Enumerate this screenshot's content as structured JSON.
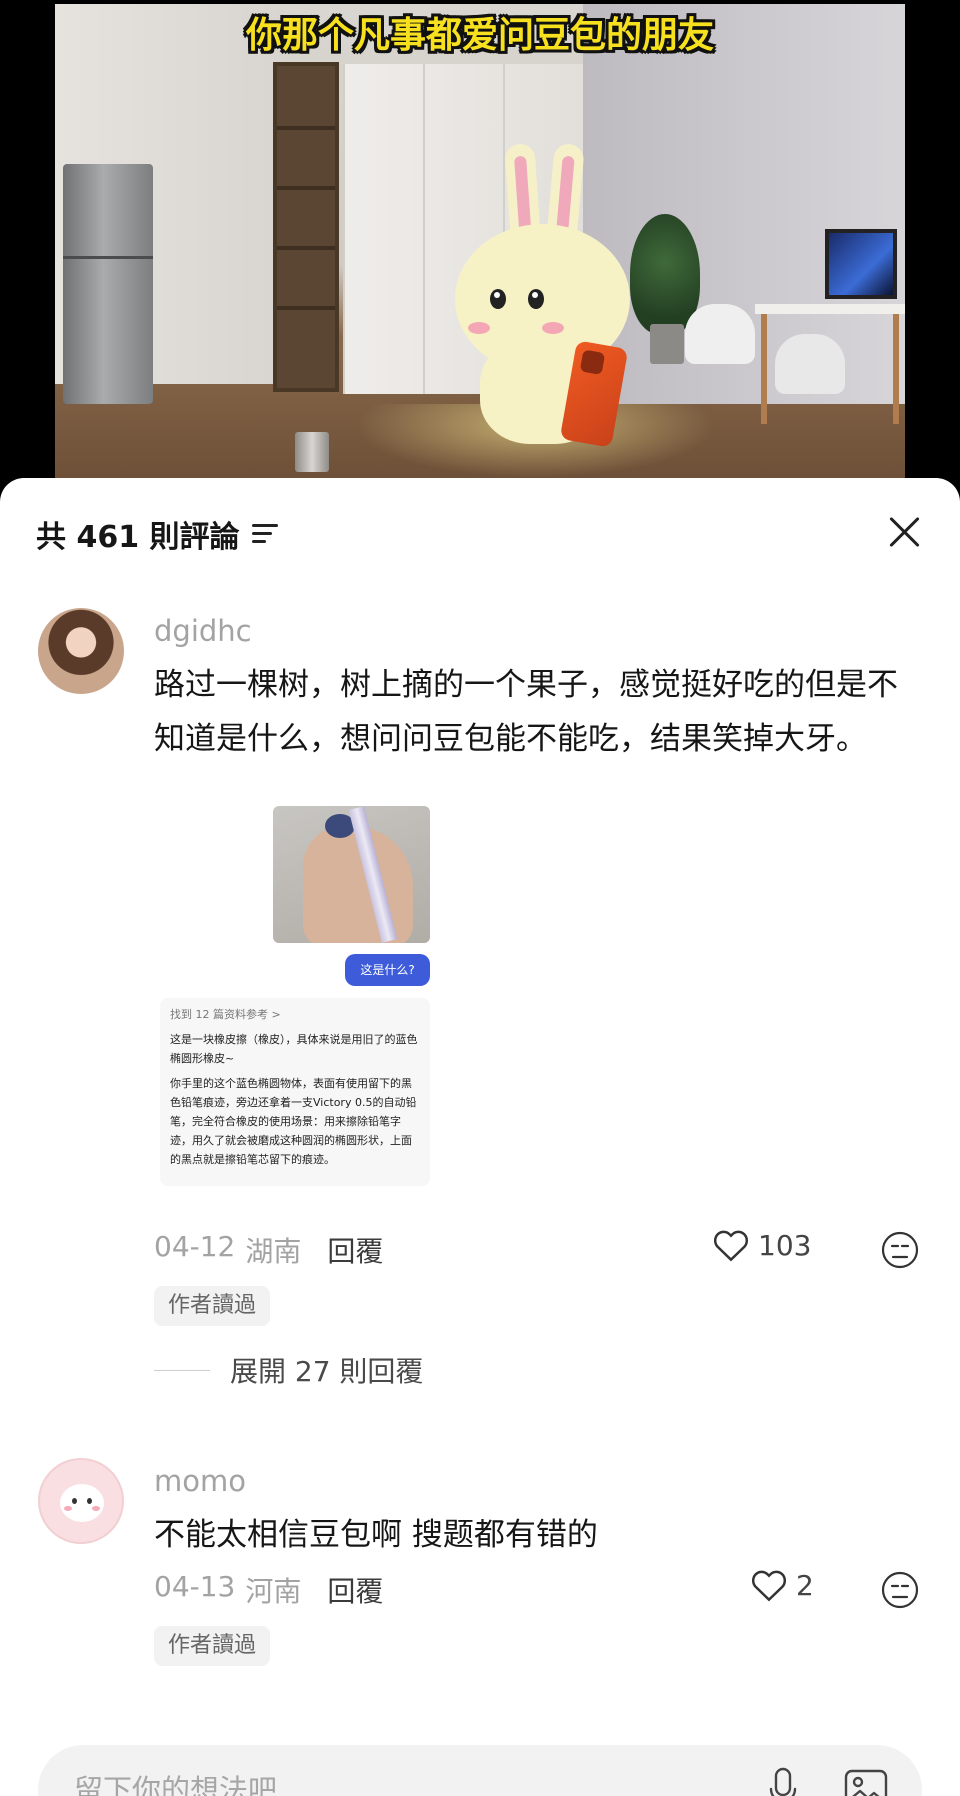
{
  "video": {
    "title": "你那个凡事都爱问豆包的朋友"
  },
  "comments_panel": {
    "count_label": "共 461 則評論",
    "sort_icon": "filter-lines-icon",
    "close_icon": "close-x-icon"
  },
  "comments": [
    {
      "username": "dgidhc",
      "text": "路过一棵树，树上摘的一个果子，感觉挺好吃的但是不知道是什么，想问问豆包能不能吃，结果笑掉大牙。",
      "attachment": {
        "bubble": "这是什么?",
        "ref": "找到 12 篇资料参考 >",
        "para1": "这是一块橡皮擦（橡皮），具体来说是用旧了的蓝色椭圆形橡皮~",
        "para2": "你手里的这个蓝色椭圆物体，表面有使用留下的黑色铅笔痕迹，旁边还拿着一支Victory 0.5的自动铅笔，完全符合橡皮的使用场景：用来擦除铅笔字迹，用久了就会被磨成这种圆润的椭圆形状，上面的黑点就是擦铅笔芯留下的痕迹。"
      },
      "date": "04-12",
      "location": "湖南",
      "reply_label": "回覆",
      "likes": "103",
      "badge": "作者讀過",
      "expand_label": "展開 27 則回覆"
    },
    {
      "username": "momo",
      "text": "不能太相信豆包啊 搜题都有错的",
      "date": "04-13",
      "location": "河南",
      "reply_label": "回覆",
      "likes": "2",
      "badge": "作者讀過"
    }
  ],
  "input": {
    "placeholder": "留下你的想法吧",
    "mic_icon": "microphone-icon",
    "image_icon": "image-icon"
  },
  "colors": {
    "title_yellow": "#f7e11f",
    "username_gray": "#a3a3a3",
    "bubble_blue": "#3e5cd9"
  }
}
